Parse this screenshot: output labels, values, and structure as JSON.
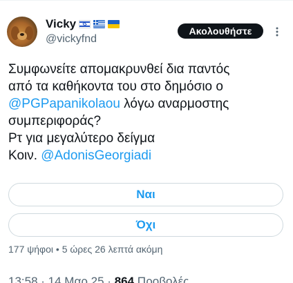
{
  "author": {
    "display_name": "Vicky",
    "handle": "@vickyfnd",
    "flags": [
      "flag-israel-icon",
      "flag-greece-icon",
      "flag-ukraine-icon"
    ]
  },
  "follow_button": {
    "label": "Ακολουθήστε"
  },
  "tweet": {
    "line1": "Συμφωνείτε απομακρυνθεί δια παντός",
    "line2": "από τα καθήκοντα του στο δημόσιο ο",
    "mention1": "@PGPapanikolaou",
    "line3_rest": " λόγω αναρμοστης",
    "line4": "συμπεριφοράς?",
    "line5": "Ρτ για μεγαλύτερο δείγμα",
    "line6_prefix": "Κοιν. ",
    "mention2": "@AdonisGeorgiadi"
  },
  "poll": {
    "options": [
      "Ναι",
      "Όχι"
    ],
    "votes": "177 ψήφοι",
    "separator": " • ",
    "time_left": "5 ώρες 26 λεπτά ακόμη"
  },
  "footer": {
    "timestamp": "13:58 · 14 Μαρ 25 · ",
    "views_count": "864",
    "views_label": " Προβολές"
  },
  "colors": {
    "accent": "#1d9bf0",
    "text": "#0f1419",
    "secondary": "#536471",
    "border": "#cfd9de"
  }
}
